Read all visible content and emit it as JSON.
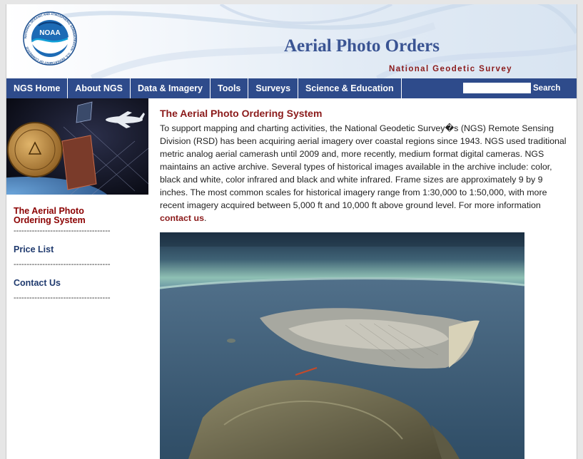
{
  "header": {
    "title": "Aerial Photo Orders",
    "subtitle": "National Geodetic Survey",
    "logo_text": "NOAA",
    "seal_text": "NATIONAL OCEANIC AND ATMOSPHERIC ADMINISTRATION · U.S. DEPARTMENT OF COMMERCE"
  },
  "nav": {
    "items": [
      {
        "label": "NGS Home"
      },
      {
        "label": "About NGS"
      },
      {
        "label": "Data & Imagery"
      },
      {
        "label": "Tools"
      },
      {
        "label": "Surveys"
      },
      {
        "label": "Science & Education"
      }
    ],
    "search_button": "Search",
    "search_value": ""
  },
  "sidebar": {
    "active_item": "The Aerial Photo Ordering System",
    "separator": "-------------------------------------",
    "links": [
      {
        "label": "Price List"
      },
      {
        "label": "Contact Us"
      }
    ]
  },
  "main": {
    "heading": "The Aerial Photo Ordering System",
    "body": "To support mapping and charting activities, the National Geodetic Survey�s (NGS) Remote Sensing Division (RSD) has been acquiring aerial imagery over coastal regions since 1943. NGS used traditional metric analog aerial camerash until 2009 and, more recently, medium format digital cameras. NGS maintains an active archive. Several types of historical images available in the archive include: color, black and white, color infrared and black and white infrared. Frame sizes are approximately 9 by 9 inches. The most common scales for historical imagery range from 1:30,000 to 1:50,000, with more recent imagery acquired between 5,000 ft and 10,000 ft above ground level. For more information ",
    "contact_link": "contact us",
    "end_punct": "."
  },
  "colors": {
    "nav_bg": "#2e4b8b",
    "title": "#3a5493",
    "accent_red": "#8b1a1a",
    "link_blue": "#1f3a6e"
  }
}
